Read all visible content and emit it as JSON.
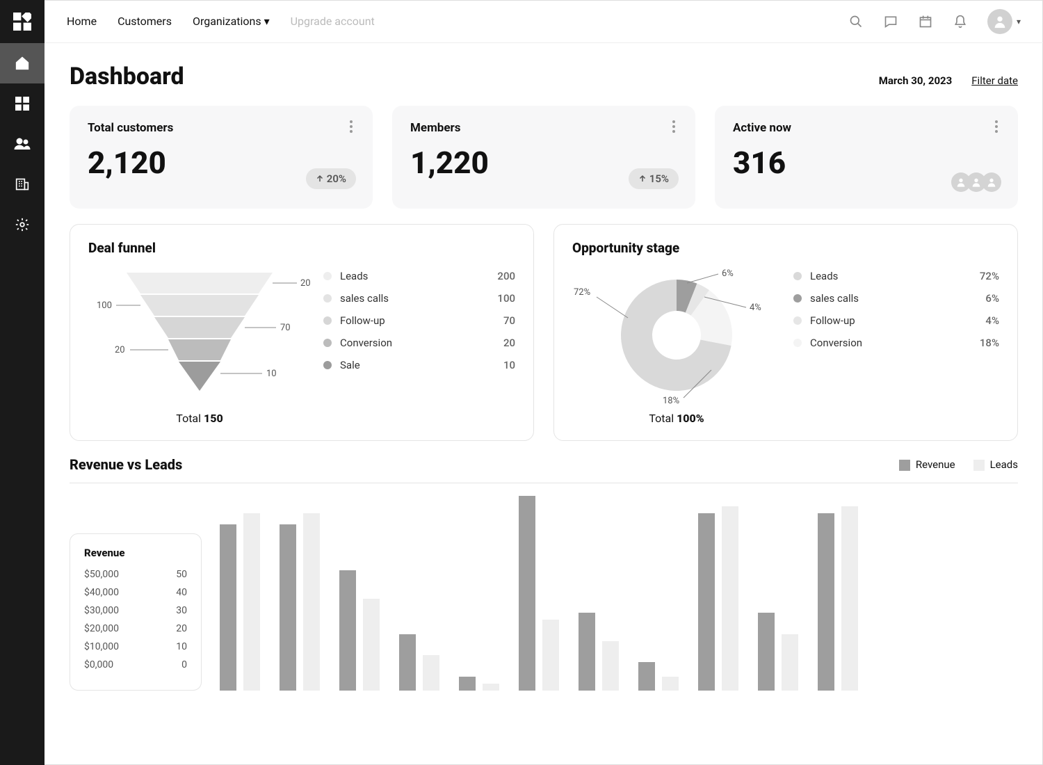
{
  "nav": {
    "top": [
      "Home",
      "Customers",
      "Organizations",
      "Upgrade account"
    ]
  },
  "header": {
    "title": "Dashboard",
    "date": "March 30, 2023",
    "filter": "Filter date"
  },
  "stats": [
    {
      "label": "Total customers",
      "value": "2,120",
      "delta": "20%"
    },
    {
      "label": "Members",
      "value": "1,220",
      "delta": "15%"
    },
    {
      "label": "Active now",
      "value": "316"
    }
  ],
  "funnel": {
    "title": "Deal funnel",
    "total_label": "Total",
    "total_value": "150",
    "rows": [
      {
        "label": "Leads",
        "value": 200,
        "color": "#eeeeee"
      },
      {
        "label": "sales calls",
        "value": 100,
        "color": "#e3e3e3"
      },
      {
        "label": "Follow-up",
        "value": 70,
        "color": "#d6d6d6"
      },
      {
        "label": "Conversion",
        "value": 20,
        "color": "#bcbcbc"
      },
      {
        "label": "Sale",
        "value": 10,
        "color": "#9c9c9c"
      }
    ]
  },
  "opportunity": {
    "title": "Opportunity stage",
    "total_label": "Total",
    "total_value": "100%",
    "rows": [
      {
        "label": "Leads",
        "value": "72%",
        "color": "#d9d9d9"
      },
      {
        "label": "sales calls",
        "value": "6%",
        "color": "#9e9e9e"
      },
      {
        "label": "Follow-up",
        "value": "4%",
        "color": "#e6e6e6"
      },
      {
        "label": "Conversion",
        "value": "18%",
        "color": "#f4f4f4"
      }
    ]
  },
  "revenue": {
    "title": "Revenue vs Leads",
    "legend": [
      {
        "label": "Revenue",
        "color": "#9e9e9e"
      },
      {
        "label": "Leads",
        "color": "#eeeeee"
      }
    ],
    "card": {
      "title": "Revenue",
      "rows": [
        {
          "left": "$50,000",
          "right": "50"
        },
        {
          "left": "$40,000",
          "right": "40"
        },
        {
          "left": "$30,000",
          "right": "30"
        },
        {
          "left": "$20,000",
          "right": "20"
        },
        {
          "left": "$10,000",
          "right": "10"
        },
        {
          "left": "$0,000",
          "right": "0"
        }
      ]
    }
  },
  "chart_data": [
    {
      "type": "bar",
      "title": "Deal funnel",
      "categories": [
        "Leads",
        "sales calls",
        "Follow-up",
        "Conversion",
        "Sale"
      ],
      "values": [
        200,
        100,
        70,
        20,
        10
      ],
      "total": 150
    },
    {
      "type": "pie",
      "title": "Opportunity stage",
      "categories": [
        "Leads",
        "sales calls",
        "Follow-up",
        "Conversion"
      ],
      "values": [
        72,
        6,
        4,
        18
      ],
      "total": 100
    },
    {
      "type": "bar",
      "title": "Revenue vs Leads",
      "ylabel": "Revenue ($)",
      "ylim": [
        0,
        55000
      ],
      "series": [
        {
          "name": "Revenue",
          "values": [
            47000,
            47000,
            34000,
            16000,
            4000,
            55000,
            22000,
            8000,
            50000,
            22000,
            50000
          ]
        },
        {
          "name": "Leads",
          "values": [
            50,
            50,
            26,
            10,
            2,
            20,
            14,
            4,
            52,
            16,
            52
          ]
        }
      ]
    }
  ]
}
